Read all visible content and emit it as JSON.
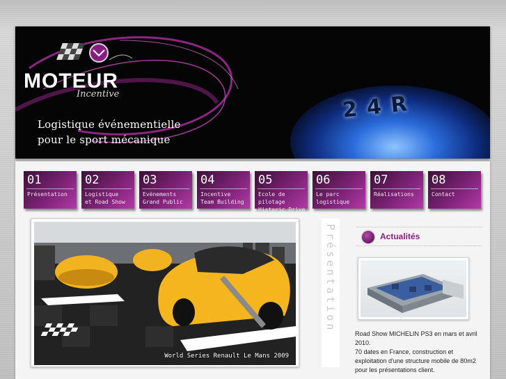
{
  "brand": {
    "logo_main": "MOTEUR",
    "logo_sub": "Incentive",
    "tagline_line1": "Logistique événementielle",
    "tagline_line2": "pour le sport mécanique",
    "shifter_text": "24R"
  },
  "nav": {
    "items": [
      {
        "num": "01",
        "label": "Présentation"
      },
      {
        "num": "02",
        "label": "Logistique\net Road Show"
      },
      {
        "num": "03",
        "label": "Evènements\nGrand Public"
      },
      {
        "num": "04",
        "label": "Incentive\nTeam Building"
      },
      {
        "num": "05",
        "label": "Ecole de pilotage\nHistoric Drive"
      },
      {
        "num": "06",
        "label": "Le parc\nlogistique"
      },
      {
        "num": "07",
        "label": "Réalisations"
      },
      {
        "num": "08",
        "label": "Contact"
      }
    ]
  },
  "section": {
    "vertical_label": "Présentation",
    "photo_caption": "World Series Renault Le Mans 2009"
  },
  "news": {
    "title": "Actualités",
    "text": "Road Show MICHELIN PS3 en mars et avril 2010.\n70 dates en France, construction et exploitation d'une structure mobile de 80m2 pour les présentations client."
  },
  "colors": {
    "accent": "#8a1e80",
    "nav_dark": "#3a1236",
    "nav_light": "#b23aa6"
  }
}
